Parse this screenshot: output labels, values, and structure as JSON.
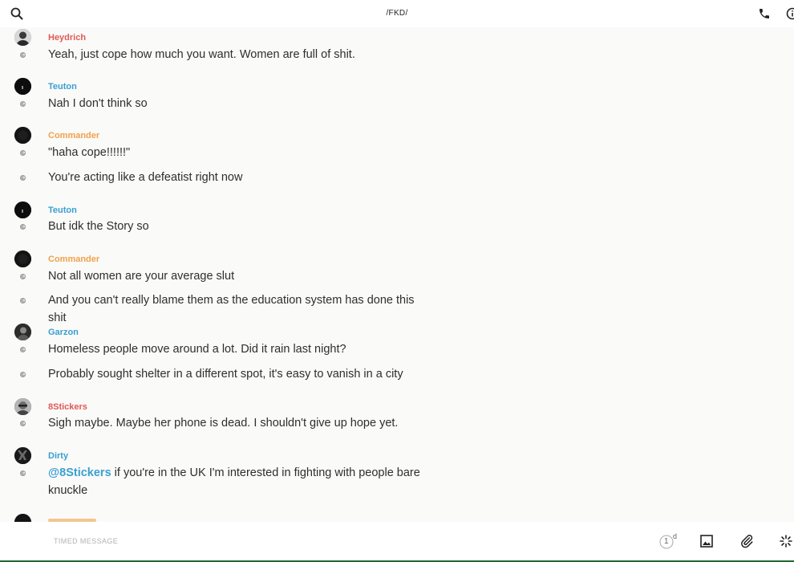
{
  "header": {
    "title": "/FKD/",
    "icons": [
      "search-icon",
      "phone-icon",
      "info-icon"
    ]
  },
  "colors": {
    "heydrich": "#e05a56",
    "teuton": "#3a9fd1",
    "commander": "#f0a24a",
    "garzon": "#3a9fd1",
    "8stickers": "#e05a56",
    "dirty": "#3a9fd1",
    "mention": "#3a9fd1"
  },
  "messages": [
    {
      "author": "Heydrich",
      "lines": [
        "Yeah, just cope how much you want. Women are full of shit."
      ]
    },
    {
      "author": "Teuton",
      "lines": [
        "Nah I don't think so"
      ]
    },
    {
      "author": "Commander",
      "lines": [
        "\"haha cope!!!!!!\"",
        "You're acting like a defeatist right now"
      ]
    },
    {
      "author": "Teuton",
      "lines": [
        "But idk the Story so"
      ]
    },
    {
      "author": "Commander",
      "lines": [
        "Not all women are your average slut",
        "And you can't really blame them as the education system has done this shit"
      ]
    },
    {
      "author": "Garzon",
      "lines": [
        "Homeless people move around a lot. Did it rain last night?",
        "Probably sought shelter in a different spot, it's easy to vanish in a city"
      ]
    },
    {
      "author": "8Stickers",
      "lines": [
        "Sigh maybe. Maybe her phone is dead. I shouldn't give up hope yet."
      ]
    },
    {
      "author": "Dirty",
      "mention": "@8Stickers",
      "lines": [
        "if you're in the UK I'm interested in fighting with people bare",
        "knuckle"
      ]
    }
  ],
  "composer": {
    "placeholder": "TIMED MESSAGE",
    "timer_count": "1",
    "timer_unit": "d",
    "icons": [
      "timer-icon",
      "image-icon",
      "paperclip-icon",
      "sparkle-icon"
    ]
  }
}
